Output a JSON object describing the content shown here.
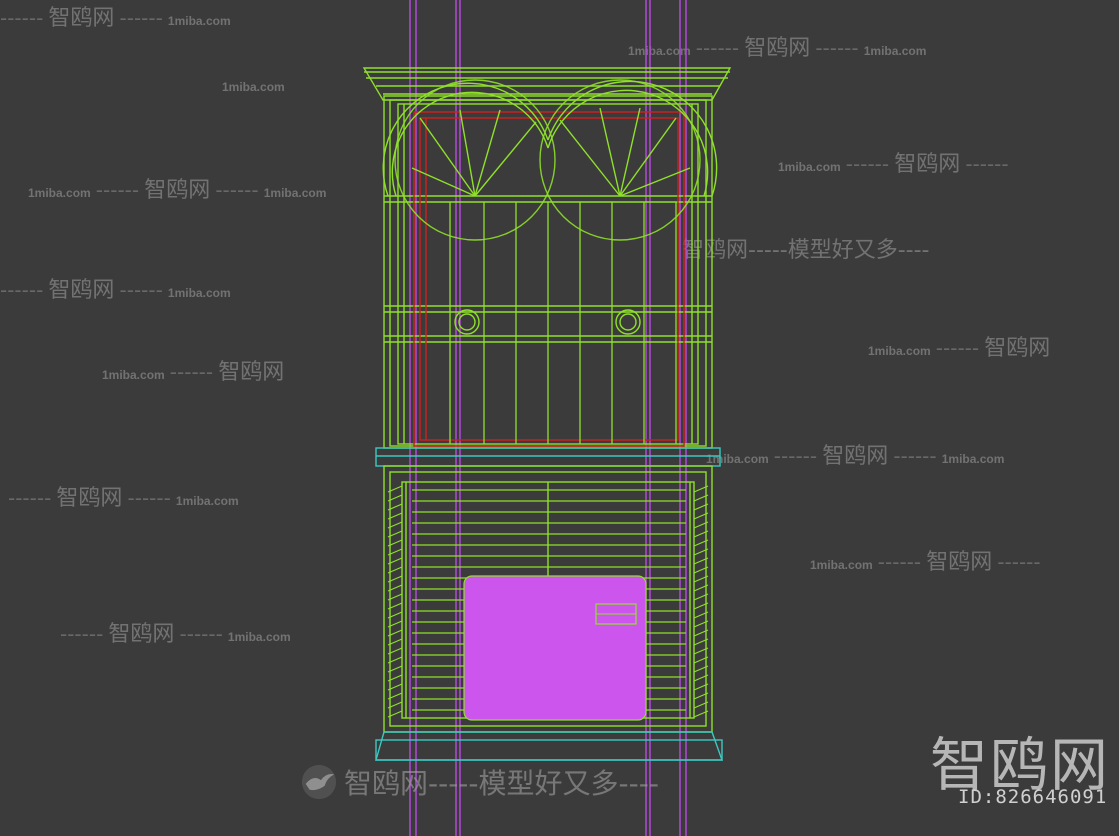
{
  "watermark": {
    "site": "1miba.com",
    "brand_cn": "智鸥网",
    "dashes": "------",
    "slogan": "智鸥网-----模型好又多----"
  },
  "brand_mark": {
    "label": "智鸥网",
    "id_label": "ID:826646091"
  },
  "colors": {
    "background": "#3b3b3b",
    "wire_green": "#8fe02a",
    "wire_red": "#d21f1f",
    "guide_purple": "#b24ad8",
    "fill_magenta": "#cc55ee",
    "wire_cyan": "#3cc8c0"
  }
}
